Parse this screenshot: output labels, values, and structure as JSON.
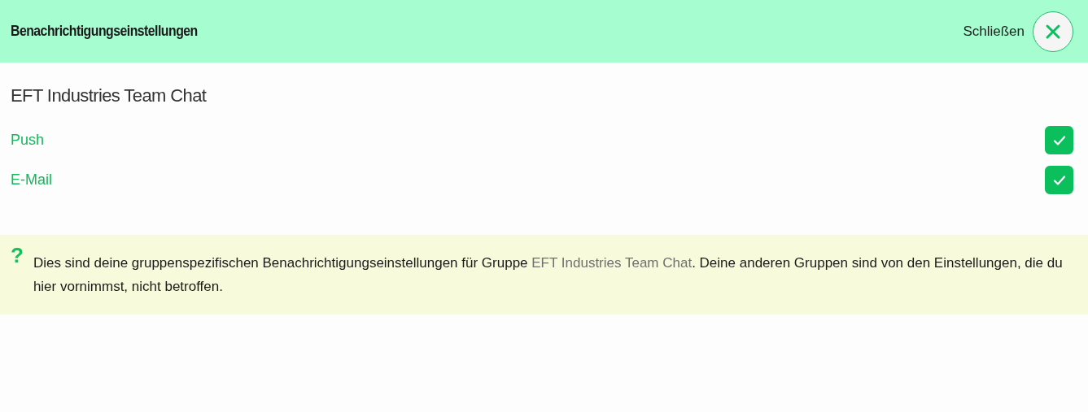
{
  "header": {
    "title": "Benachrichtigungseinstellungen",
    "close_label": "Schließen"
  },
  "group": {
    "title": "EFT Industries Team Chat"
  },
  "options": [
    {
      "label": "Push",
      "checked": true
    },
    {
      "label": "E-Mail",
      "checked": true
    }
  ],
  "info": {
    "mark": "?",
    "text_before": "Dies sind deine gruppenspezifischen Benachrichtigungseinstellungen für Gruppe ",
    "group_name": "EFT Industries Team Chat",
    "text_after": ". Deine anderen Gruppen sind von den Einstellungen, die du hier vornimmst, nicht betroffen."
  }
}
